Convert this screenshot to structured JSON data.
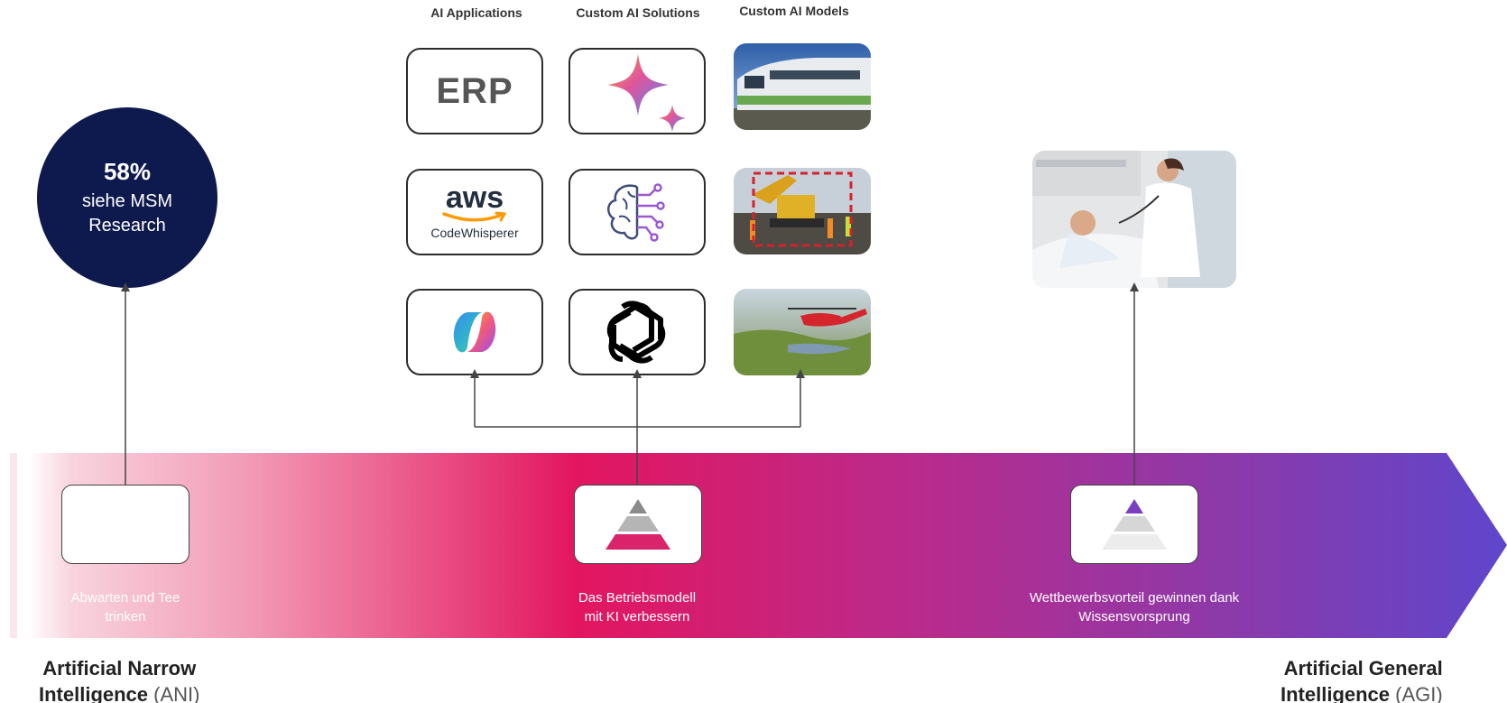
{
  "columns": {
    "apps": "AI Applications",
    "solutions": "Custom AI Solutions",
    "models": "Custom AI Models"
  },
  "tiles": {
    "erp": "ERP",
    "aws": "aws",
    "codewhisperer": "CodeWhisperer"
  },
  "circle": {
    "percent": "58%",
    "line1": "siehe MSM",
    "line2": "Research"
  },
  "stages": [
    {
      "line1": "Abwarten und Tee",
      "line2": "trinken"
    },
    {
      "line1": "Das Betriebsmodell",
      "line2": "mit KI verbessern"
    },
    {
      "line1": "Wettbewerbsvorteil gewinnen dank",
      "line2": "Wissensvorsprung"
    }
  ],
  "ani": {
    "bold1": "Artificial Narrow",
    "bold2": "Intelligence",
    "abbr": "(ANI)"
  },
  "agi": {
    "bold1": "Artificial General",
    "bold2": "Intelligence",
    "abbr": "(AGI)"
  },
  "colors": {
    "circle": "#0e1a4e",
    "band_start": "#f6c4d2",
    "band_mid": "#e3165f",
    "band_end": "#6246c8",
    "pyramid_pink": "#d9246b",
    "pyramid_purple": "#7a3fbf"
  }
}
